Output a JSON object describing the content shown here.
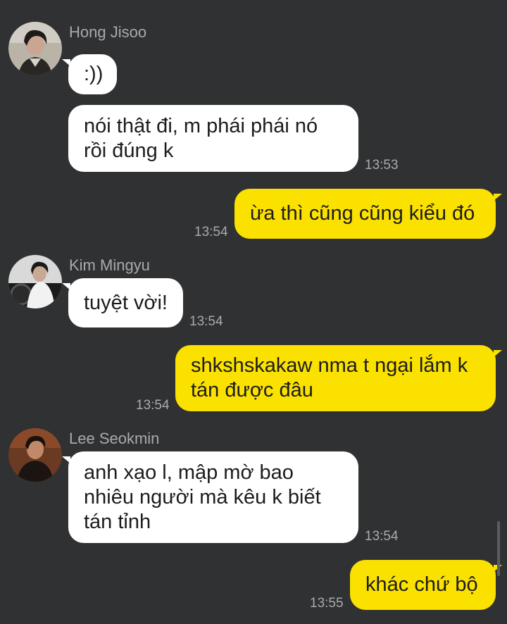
{
  "messages": [
    {
      "sender": "Hong Jisoo",
      "text": ":))",
      "time": ""
    },
    {
      "sender": "Hong Jisoo",
      "text": "nói thật đi, m phái phái nó\nrồi đúng k",
      "time": "13:53"
    },
    {
      "sender": "me",
      "text": "ừa thì cũng cũng kiểu đó",
      "time": "13:54"
    },
    {
      "sender": "Kim Mingyu",
      "text": "tuyệt vời!",
      "time": "13:54"
    },
    {
      "sender": "me",
      "text": "shkshskakaw nma t ngại lắm k\ntán được đâu",
      "time": "13:54"
    },
    {
      "sender": "Lee Seokmin",
      "text": "anh xạo l, mập mờ bao\nnhiêu người mà kêu k biết\ntán tỉnh",
      "time": "13:54"
    },
    {
      "sender": "me",
      "text": "khác chứ bộ",
      "time": "13:55"
    }
  ],
  "colors": {
    "background": "#303132",
    "incoming_bubble": "#ffffff",
    "outgoing_bubble": "#fae100",
    "meta_text": "#a8aaad"
  }
}
